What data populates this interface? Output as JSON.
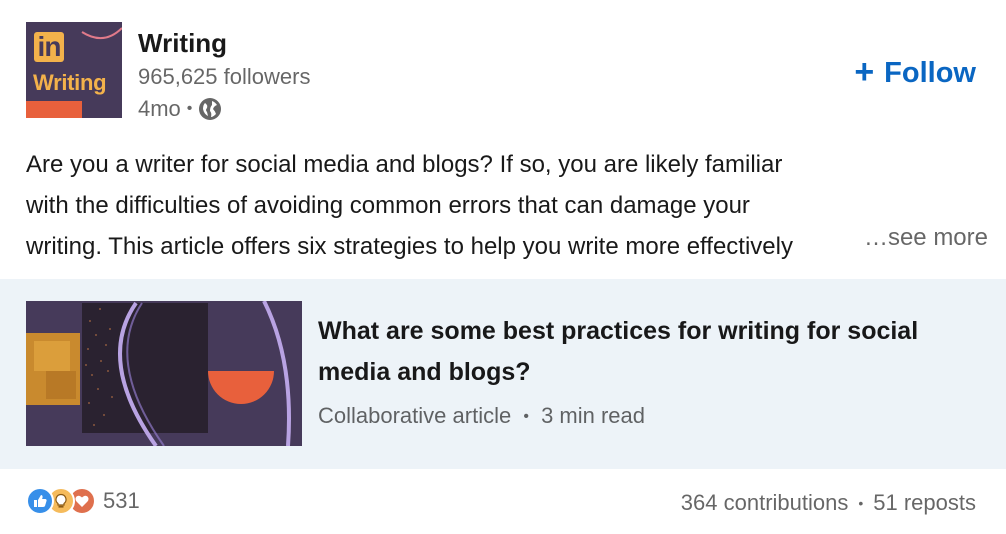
{
  "author": {
    "logo_badge": "in",
    "logo_word": "Writing",
    "name": "Writing",
    "followers": "965,625 followers",
    "time": "4mo",
    "visibility_icon": "globe-icon"
  },
  "follow": {
    "icon": "plus-icon",
    "label": "Follow"
  },
  "post": {
    "line1": "Are you a writer for social media and blogs? If so, you are likely familiar",
    "line2": "with the difficulties of avoiding common errors that can damage your",
    "line3": "writing. This article offers six strategies to help you write more effectively",
    "see_more": "…see more"
  },
  "article": {
    "title": "What are some best practices for writing for social media and blogs?",
    "type": "Collaborative article",
    "read_time": "3 min read"
  },
  "social": {
    "reaction_icons": [
      "like-icon",
      "insightful-icon",
      "love-icon"
    ],
    "reaction_count": "531",
    "contributions": "364 contributions",
    "reposts": "51 reposts"
  },
  "colors": {
    "accent": "#0a66c2",
    "card_bg": "#edf3f8",
    "logo_bg": "#463a5a",
    "logo_gold": "#f3b24b",
    "logo_orange": "#e8603c"
  }
}
